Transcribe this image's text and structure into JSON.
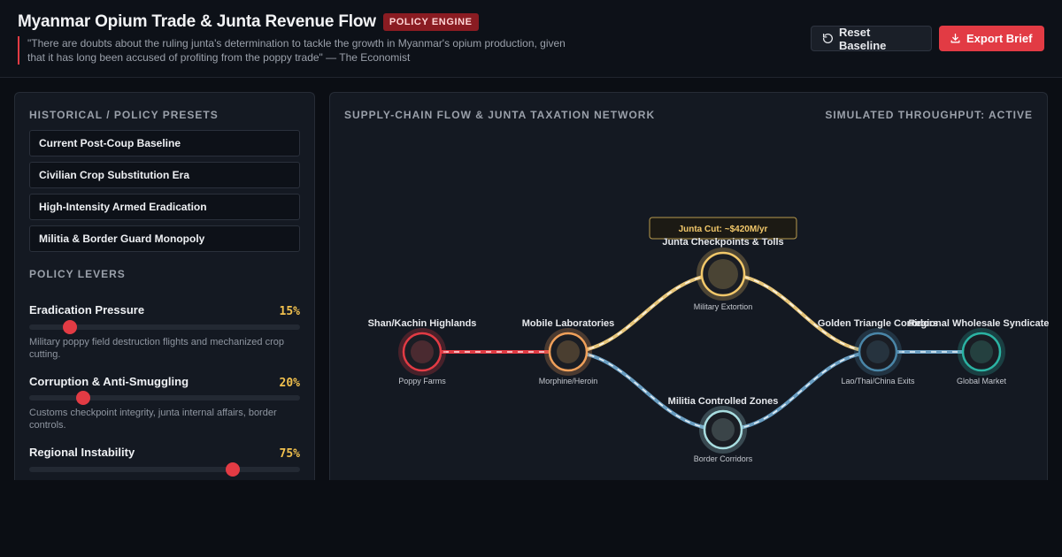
{
  "header": {
    "title": "Myanmar Opium Trade & Junta Revenue Flow",
    "badge": "POLICY ENGINE",
    "quote": "\"There are doubts about the ruling junta's determination to tackle the growth in Myanmar's opium production, given that it has long been accused of profiting from the poppy trade\" — The Economist",
    "reset_label": "Reset Baseline",
    "export_label": "Export Brief"
  },
  "presets": {
    "title": "HISTORICAL / POLICY PRESETS",
    "items": [
      {
        "label": "Current Post-Coup Baseline",
        "active": true
      },
      {
        "label": "Civilian Crop Substitution Era",
        "active": false
      },
      {
        "label": "High-Intensity Armed Eradication",
        "active": false
      },
      {
        "label": "Militia & Border Guard Monopoly",
        "active": false
      }
    ]
  },
  "levers": {
    "title": "POLICY LEVERS",
    "items": [
      {
        "label": "Eradication Pressure",
        "value_text": "15%",
        "value": 15,
        "desc": "Military poppy field destruction flights and mechanized crop cutting."
      },
      {
        "label": "Corruption & Anti-Smuggling",
        "value_text": "20%",
        "value": 20,
        "desc": "Customs checkpoint integrity, junta internal affairs, border controls."
      },
      {
        "label": "Regional Instability",
        "value_text": "75%",
        "value": 75,
        "desc": ""
      }
    ]
  },
  "network": {
    "title": "SUPPLY-CHAIN FLOW & JUNTA TAXATION NETWORK",
    "status": "SIMULATED THROUGHPUT: ACTIVE",
    "tooltip": "Junta Cut: ~$420M/yr",
    "nodes": [
      {
        "label": "Shan/Kachin Highlands",
        "sub": "Poppy Farms",
        "color": "#e23b44"
      },
      {
        "label": "Mobile Laboratories",
        "sub": "Morphine/Heroin",
        "color": "#f0a05a"
      },
      {
        "label": "Junta Checkpoints & Tolls",
        "sub": "Military Extortion",
        "color": "#f2c86a"
      },
      {
        "label": "Militia Controlled Zones",
        "sub": "Border Corridors",
        "color": "#a8dde0"
      },
      {
        "label": "Golden Triangle Corridors",
        "sub": "Lao/Thai/China Exits",
        "color": "#4a86a8"
      },
      {
        "label": "Regional Wholesale Syndicates",
        "sub": "Global Market",
        "color": "#2bb3a3"
      }
    ],
    "colors": {
      "farm_flow": "#e23b44",
      "toll_flow": "#e6c57a",
      "militia_flow": "#6a9ec2"
    }
  }
}
